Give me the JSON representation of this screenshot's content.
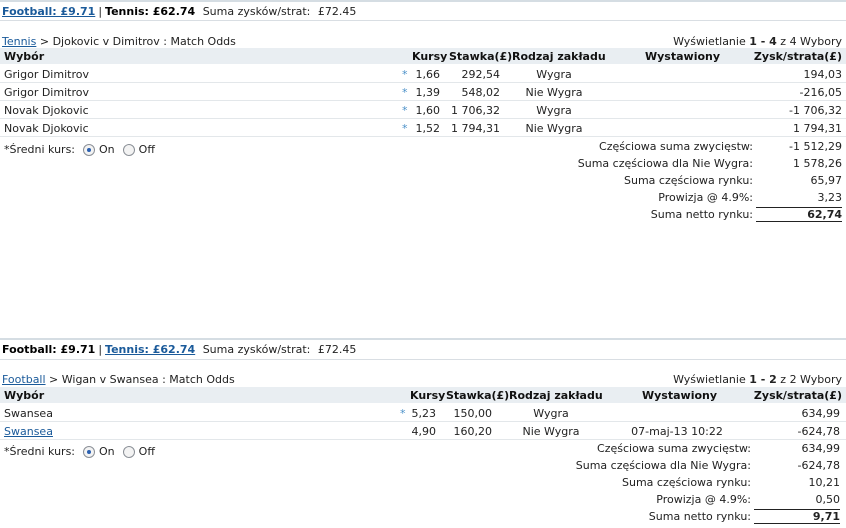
{
  "panels": [
    {
      "summary": {
        "football": "Football: £9.71",
        "tennis": "Tennis: £62.74",
        "total_label": "Suma zysków/strat:",
        "total_value": "£72.45"
      },
      "breadcrumb": {
        "sport": "Tennis",
        "rest": " > Djokovic v Dimitrov : Match Odds"
      },
      "display": {
        "prefix": "Wyświetlanie ",
        "range": "1 - 4",
        "middle": " z ",
        "count": "4",
        "suffix": " Wybory"
      },
      "headers": {
        "selection": "Wybór",
        "odds": "Kursy",
        "stake": "Stawka(£)",
        "bet_type": "Rodzaj zakładu",
        "placed": "Wystawiony",
        "pl": "Zysk/strata(£)"
      },
      "rows": [
        {
          "selection": "Grigor Dimitrov",
          "star": "*",
          "odds": "1,66",
          "stake": "292,54",
          "bet_type": "Wygra",
          "placed": "",
          "pl": "194,03"
        },
        {
          "selection": "Grigor Dimitrov",
          "star": "*",
          "odds": "1,39",
          "stake": "548,02",
          "bet_type": "Nie Wygra",
          "placed": "",
          "pl": "-216,05"
        },
        {
          "selection": "Novak Djokovic",
          "star": "*",
          "odds": "1,60",
          "stake": "1 706,32",
          "bet_type": "Wygra",
          "placed": "",
          "pl": "-1 706,32"
        },
        {
          "selection": "Novak Djokovic",
          "star": "*",
          "odds": "1,52",
          "stake": "1 794,31",
          "bet_type": "Nie Wygra",
          "placed": "",
          "pl": "1 794,31"
        }
      ],
      "avg_odds": {
        "label": "*Średni kurs:",
        "on": "On",
        "off": "Off",
        "selected": "on"
      },
      "totals": [
        {
          "label": "Częściowa suma zwycięstw:",
          "value": "-1 512,29"
        },
        {
          "label": "Suma częściowa dla Nie Wygra:",
          "value": "1 578,26"
        },
        {
          "label": "Suma częściowa rynku:",
          "value": "65,97"
        },
        {
          "label": "Prowizja @ 4.9%:",
          "value": "3,23"
        },
        {
          "label": "Suma netto rynku:",
          "value": "62,74"
        }
      ]
    },
    {
      "summary": {
        "football": "Football: £9.71",
        "tennis": "Tennis: £62.74",
        "total_label": "Suma zysków/strat:",
        "total_value": "£72.45"
      },
      "breadcrumb": {
        "sport": "Football",
        "rest": " > Wigan v Swansea : Match Odds"
      },
      "display": {
        "prefix": "Wyświetlanie ",
        "range": "1 - 2",
        "middle": " z ",
        "count": "2",
        "suffix": " Wybory"
      },
      "headers": {
        "selection": "Wybór",
        "odds": "Kursy",
        "stake": "Stawka(£)",
        "bet_type": "Rodzaj zakładu",
        "placed": "Wystawiony",
        "pl": "Zysk/strata(£)"
      },
      "rows": [
        {
          "selection": "Swansea",
          "star": "*",
          "odds": "5,23",
          "stake": "150,00",
          "bet_type": "Wygra",
          "placed": "",
          "pl": "634,99"
        },
        {
          "selection": "Swansea",
          "star": "",
          "odds": "4,90",
          "stake": "160,20",
          "bet_type": "Nie Wygra",
          "placed": "07-maj-13 10:22",
          "pl": "-624,78"
        }
      ],
      "avg_odds": {
        "label": "*Średni kurs:",
        "on": "On",
        "off": "Off",
        "selected": "on"
      },
      "totals": [
        {
          "label": "Częściowa suma zwycięstw:",
          "value": "634,99"
        },
        {
          "label": "Suma częściowa dla Nie Wygra:",
          "value": "-624,78"
        },
        {
          "label": "Suma częściowa rynku:",
          "value": "10,21"
        },
        {
          "label": "Prowizja @ 4.9%:",
          "value": "0,50"
        },
        {
          "label": "Suma netto rynku:",
          "value": "9,71"
        }
      ]
    }
  ]
}
